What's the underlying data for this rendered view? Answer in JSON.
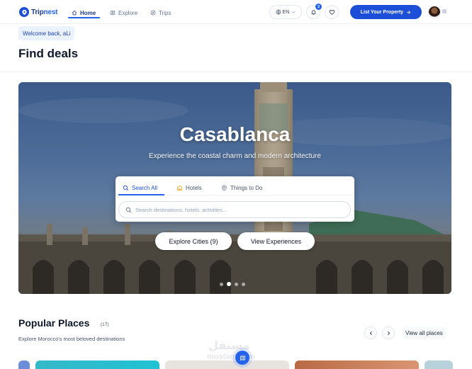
{
  "brand": {
    "logo_text_main": "Trip",
    "logo_text_accent": "nest"
  },
  "nav": {
    "links": [
      {
        "label": "Home",
        "icon": "home-icon",
        "active": true
      },
      {
        "label": "Explore",
        "icon": "map-icon",
        "active": false
      },
      {
        "label": "Trips",
        "icon": "compass-icon",
        "active": false
      }
    ],
    "language": "EN",
    "notifications_count": "3",
    "list_property_label": "List Your Property"
  },
  "header": {
    "welcome": "Welcome back, aLi",
    "title": "Find deals"
  },
  "hero": {
    "city": "Casablanca",
    "tagline": "Experience the coastal charm and modern architecture",
    "search_tabs": [
      {
        "label": "Search All",
        "icon": "search-icon",
        "active": true
      },
      {
        "label": "Hotels",
        "icon": "hotel-icon",
        "active": false
      },
      {
        "label": "Things to Do",
        "icon": "pin-icon",
        "active": false
      }
    ],
    "search_placeholder": "Search destinations, hotels, activities...",
    "explore_cities_label": "Explore Cities (9)",
    "view_experiences_label": "View Experiences",
    "slide_count": 4,
    "active_slide": 2
  },
  "popular": {
    "title": "Popular Places",
    "count": "(17)",
    "subtitle": "Explore Morocco's most beloved destinations",
    "view_all_label": "View all places"
  },
  "watermark": {
    "arabic": "مستقل",
    "latin": "mostaql.com"
  },
  "colors": {
    "primary": "#1d4ed8",
    "accent": "#2563eb",
    "text": "#0f172a"
  }
}
